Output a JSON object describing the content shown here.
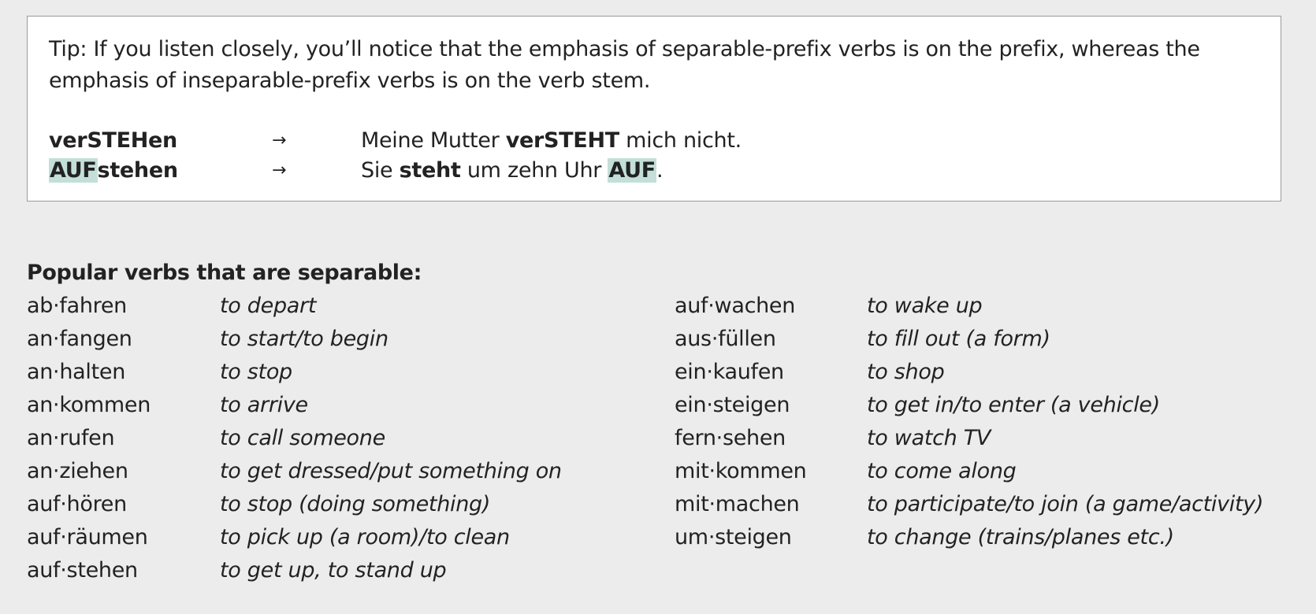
{
  "tip": {
    "text": "Tip: If you listen closely, you’ll notice that the emphasis of separable-prefix verbs is on the prefix, whereas the emphasis of inseparable-prefix verbs is on the verb stem.",
    "examples": [
      {
        "verb_highlight": "",
        "verb_rest": "verSTEHen",
        "arrow": "→",
        "sentence_pre": "Meine Mutter ",
        "sentence_bold": "verSTEHT",
        "sentence_mid": " mich nicht.",
        "sentence_highlight": "",
        "sentence_end": ""
      },
      {
        "verb_highlight": "AUF",
        "verb_rest": "stehen",
        "arrow": "→",
        "sentence_pre": "Sie ",
        "sentence_bold": "steht",
        "sentence_mid": " um zehn Uhr ",
        "sentence_highlight": "AUF",
        "sentence_end": "."
      }
    ],
    "highlight_color": "#c3dfd8"
  },
  "separable": {
    "title": "Popular verbs that are separable:",
    "left_column": [
      {
        "verb": "ab·fahren",
        "meaning": "to depart"
      },
      {
        "verb": "an·fangen",
        "meaning": "to start/to begin"
      },
      {
        "verb": "an·halten",
        "meaning": "to stop"
      },
      {
        "verb": "an·kommen",
        "meaning": "to arrive"
      },
      {
        "verb": "an·rufen",
        "meaning": "to call someone"
      },
      {
        "verb": "an·ziehen",
        "meaning": "to get dressed/put something on"
      },
      {
        "verb": "auf·hören",
        "meaning": "to stop (doing something)"
      },
      {
        "verb": "auf·räumen",
        "meaning": "to pick up (a room)/to clean"
      },
      {
        "verb": "auf·stehen",
        "meaning": "to get up, to stand up"
      }
    ],
    "right_column": [
      {
        "verb": "auf·wachen",
        "meaning": "to wake up"
      },
      {
        "verb": "aus·füllen",
        "meaning": "to fill out (a form)"
      },
      {
        "verb": "ein·kaufen",
        "meaning": "to shop"
      },
      {
        "verb": "ein·steigen",
        "meaning": "to get in/to enter (a vehicle)"
      },
      {
        "verb": "fern·sehen",
        "meaning": "to watch TV"
      },
      {
        "verb": "mit·kommen",
        "meaning": "to come along"
      },
      {
        "verb": "mit·machen",
        "meaning": "to participate/to join (a game/activity)"
      },
      {
        "verb": "um·steigen",
        "meaning": "to change (trains/planes etc.)"
      }
    ]
  }
}
